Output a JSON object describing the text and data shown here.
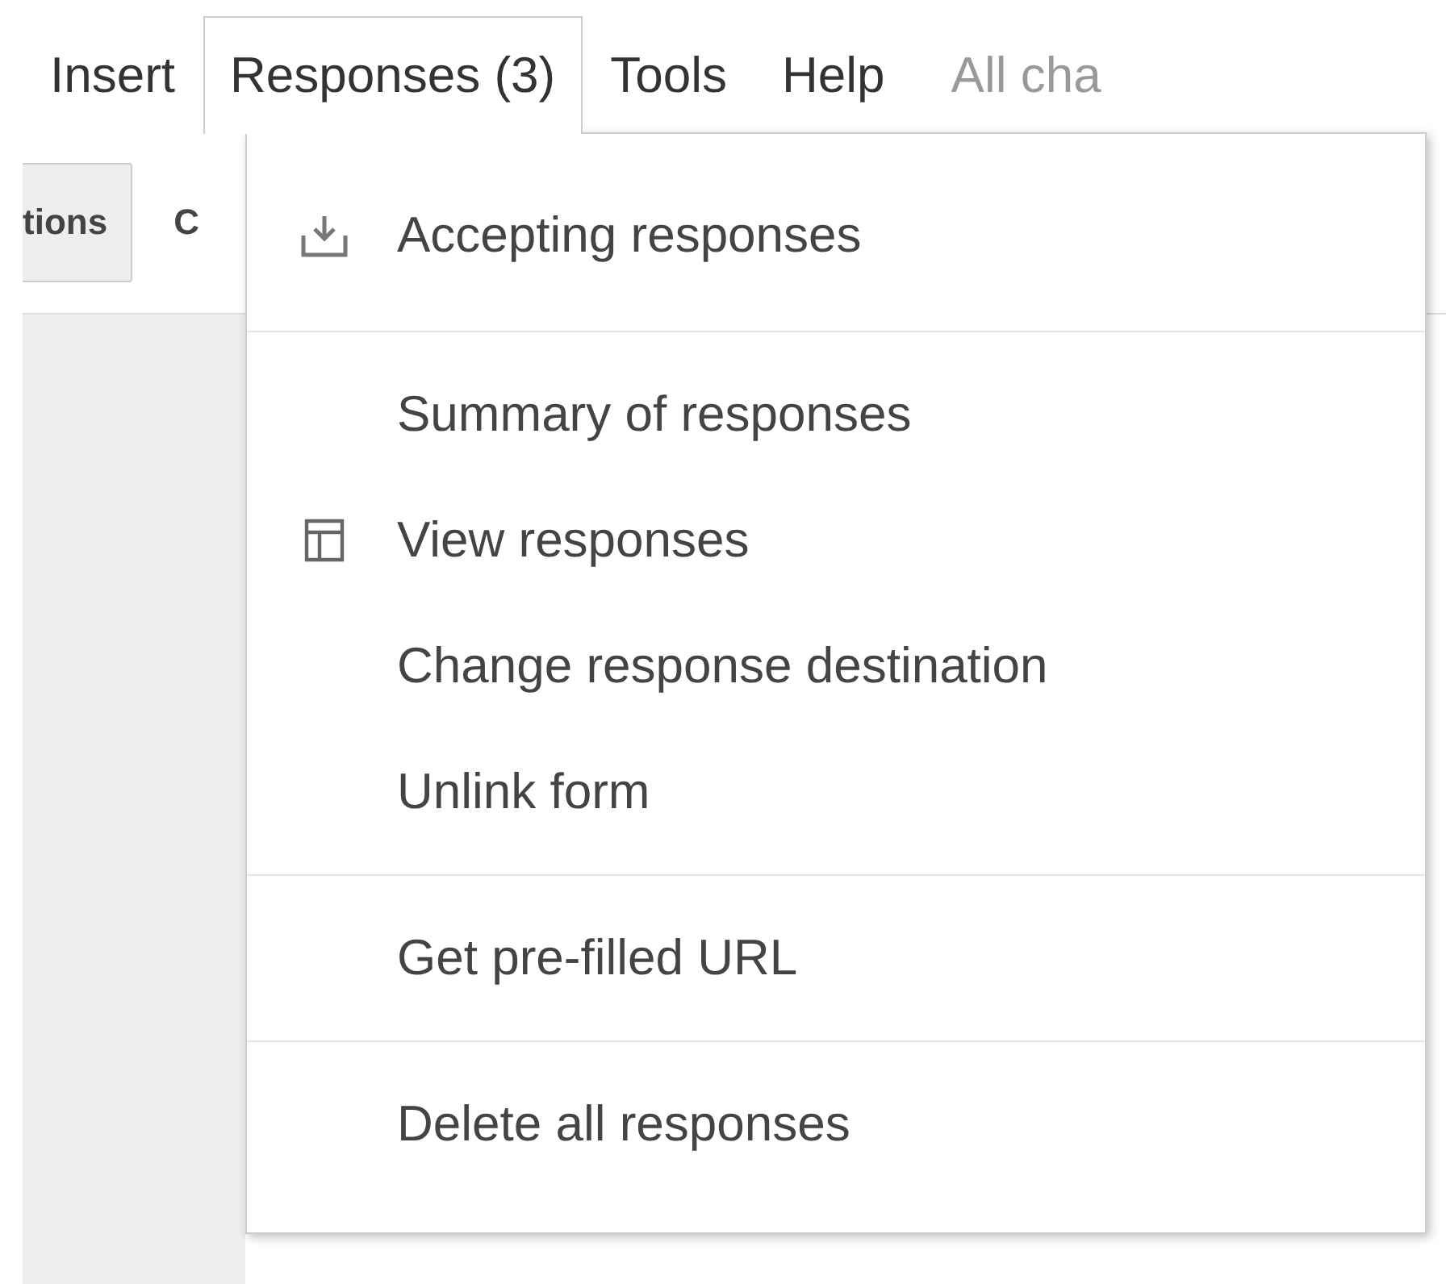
{
  "menubar": [
    {
      "label": "Insert",
      "selected": false,
      "kind": "menu"
    },
    {
      "label": "Responses (3)",
      "selected": true,
      "kind": "menu"
    },
    {
      "label": "Tools",
      "selected": false,
      "kind": "menu"
    },
    {
      "label": "Help",
      "selected": false,
      "kind": "menu"
    },
    {
      "label": "All cha",
      "kind": "status"
    }
  ],
  "toolbar": [
    {
      "label": "tions",
      "kind": "button"
    },
    {
      "label": "C",
      "kind": "text"
    }
  ],
  "menu": {
    "sections": [
      [
        {
          "label": "Accepting responses",
          "kind": "download"
        }
      ],
      [
        {
          "label": "Summary of responses"
        },
        {
          "label": "View responses",
          "kind": "table"
        },
        {
          "label": "Change response destination"
        },
        {
          "label": "Unlink form"
        }
      ],
      [
        {
          "label": "Get pre-filled URL"
        }
      ],
      [
        {
          "label": "Delete all responses"
        }
      ]
    ]
  }
}
